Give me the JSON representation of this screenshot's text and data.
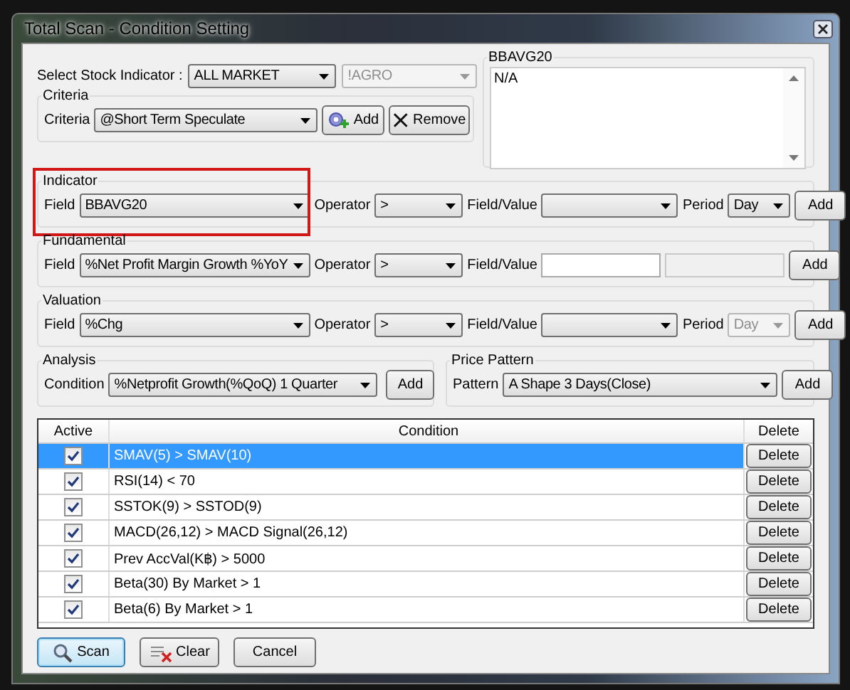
{
  "window": {
    "title": "Total Scan - Condition Setting"
  },
  "stock_indicator": {
    "label": "Select Stock Indicator :",
    "market": {
      "value": "ALL MARKET",
      "disabled": false
    },
    "sector": {
      "value": "!AGRO",
      "disabled": true
    }
  },
  "criteria": {
    "title": "Criteria",
    "label": "Criteria",
    "value": "@Short Term Speculate",
    "buttons": [
      {
        "kind": "add",
        "label": "Add"
      },
      {
        "kind": "remove",
        "label": "Remove"
      }
    ]
  },
  "description": {
    "title": "BBAVG20",
    "text": "N/A"
  },
  "sections": [
    {
      "kind": "period",
      "title": "Indicator",
      "highlighted": true,
      "field_label": "Field",
      "field": "BBAVG20",
      "operator_label": "Operator",
      "operator": ">",
      "value_label": "Field/Value",
      "period_label": "Period",
      "period": {
        "value": "Day",
        "disabled": false
      },
      "button": "Add"
    },
    {
      "kind": "range",
      "title": "Fundamental",
      "highlighted": false,
      "field_label": "Field",
      "field": "%Net Profit Margin Growth %YoY",
      "operator_label": "Operator",
      "operator": ">",
      "value_label": "Field/Value",
      "second_value": {
        "disabled": true
      },
      "button": "Add"
    },
    {
      "kind": "period",
      "title": "Valuation",
      "highlighted": false,
      "field_label": "Field",
      "field": "%Chg",
      "operator_label": "Operator",
      "operator": ">",
      "value_label": "Field/Value",
      "period_label": "Period",
      "period": {
        "value": "Day",
        "disabled": true
      },
      "button": "Add"
    }
  ],
  "analysis": {
    "title": "Analysis",
    "label": "Condition",
    "value": "%Netprofit Growth(%QoQ) 1 Quarter",
    "button": "Add"
  },
  "price_pattern": {
    "title": "Price Pattern",
    "label": "Pattern",
    "value": "A Shape 3 Days(Close)",
    "button": "Add"
  },
  "table": {
    "columns": [
      "Active",
      "Condition",
      "Delete"
    ],
    "rows": [
      {
        "active": true,
        "condition": "SMAV(5) > SMAV(10)",
        "action": "Delete",
        "selected": true
      },
      {
        "active": true,
        "condition": "RSI(14) < 70",
        "action": "Delete",
        "selected": false
      },
      {
        "active": true,
        "condition": "SSTOK(9) > SSTOD(9)",
        "action": "Delete",
        "selected": false
      },
      {
        "active": true,
        "condition": "MACD(26,12) > MACD Signal(26,12)",
        "action": "Delete",
        "selected": false
      },
      {
        "active": true,
        "condition": "Prev AccVal(K฿) > 5000",
        "action": "Delete",
        "selected": false
      },
      {
        "active": true,
        "condition": "Beta(30) By Market > 1",
        "action": "Delete",
        "selected": false
      },
      {
        "active": true,
        "condition": "Beta(6) By Market > 1",
        "action": "Delete",
        "selected": false
      }
    ]
  },
  "footer_buttons": [
    {
      "kind": "scan",
      "label": "Scan",
      "focused": true
    },
    {
      "kind": "clear",
      "label": "Clear",
      "focused": false
    },
    {
      "kind": "cancel",
      "label": "Cancel",
      "focused": false
    }
  ]
}
